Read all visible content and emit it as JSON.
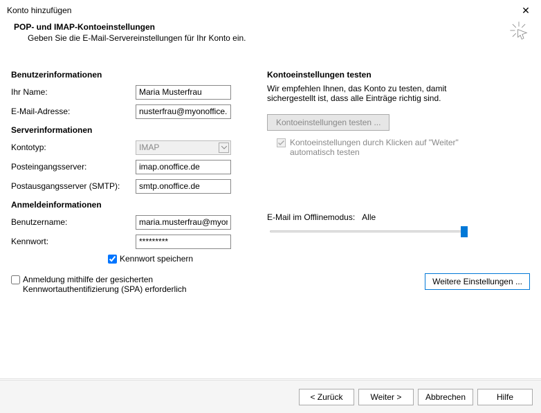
{
  "window": {
    "title": "Konto hinzufügen"
  },
  "header": {
    "title": "POP- und IMAP-Kontoeinstellungen",
    "subtitle": "Geben Sie die E-Mail-Servereinstellungen für Ihr Konto ein."
  },
  "left": {
    "user_info_title": "Benutzerinformationen",
    "name_label": "Ihr Name:",
    "name_value": "Maria Musterfrau",
    "email_label": "E-Mail-Adresse:",
    "email_value": "nusterfrau@myonoffice.com",
    "server_info_title": "Serverinformationen",
    "account_type_label": "Kontotyp:",
    "account_type_value": "IMAP",
    "incoming_label": "Posteingangsserver:",
    "incoming_value": "imap.onoffice.de",
    "outgoing_label": "Postausgangsserver (SMTP):",
    "outgoing_value": "smtp.onoffice.de",
    "login_info_title": "Anmeldeinformationen",
    "username_label": "Benutzername:",
    "username_value": "maria.musterfrau@myonoffi",
    "password_label": "Kennwort:",
    "password_value": "*********",
    "save_password_label": "Kennwort speichern",
    "spa_label": "Anmeldung mithilfe der gesicherten Kennwortauthentifizierung (SPA) erforderlich"
  },
  "right": {
    "test_title": "Kontoeinstellungen testen",
    "test_description": "Wir empfehlen Ihnen, das Konto zu testen, damit sichergestellt ist, dass alle Einträge richtig sind.",
    "test_button": "Kontoeinstellungen testen ...",
    "auto_test_label": "Kontoeinstellungen durch Klicken auf \"Weiter\" automatisch testen",
    "offline_label": "E-Mail im Offlinemodus:",
    "offline_value": "Alle",
    "more_settings": "Weitere Einstellungen ..."
  },
  "footer": {
    "back": "< Zurück",
    "next": "Weiter >",
    "cancel": "Abbrechen",
    "help": "Hilfe"
  }
}
